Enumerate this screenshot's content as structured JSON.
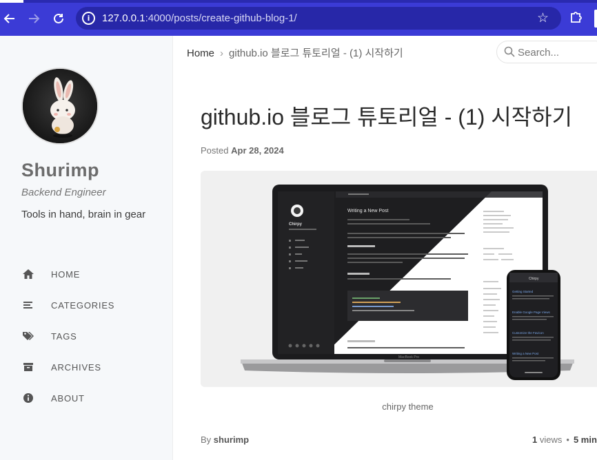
{
  "browser": {
    "url_host": "127.0.0.1",
    "url_path": ":4000/posts/create-github-blog-1/",
    "back_icon": "arrow-left-icon",
    "forward_icon": "arrow-right-icon",
    "reload_icon": "reload-icon",
    "bookmark_icon": "star-icon",
    "extensions_icon": "puzzle-icon"
  },
  "sidebar": {
    "title": "Shurimp",
    "subtitle": "Backend Engineer",
    "description": "Tools in hand, brain in gear",
    "menu": [
      {
        "label": "HOME",
        "icon": "home-icon"
      },
      {
        "label": "CATEGORIES",
        "icon": "stream-icon"
      },
      {
        "label": "TAGS",
        "icon": "tags-icon"
      },
      {
        "label": "ARCHIVES",
        "icon": "archive-icon"
      },
      {
        "label": "ABOUT",
        "icon": "info-icon"
      }
    ]
  },
  "topbar": {
    "breadcrumb_home": "Home",
    "breadcrumb_current": "github.io 블로그 튜토리얼 - (1) 시작하기",
    "search_placeholder": "Search..."
  },
  "post": {
    "title": "github.io 블로그 튜토리얼 - (1) 시작하기",
    "posted_label": "Posted",
    "posted_date": "Apr 28, 2024",
    "image_caption": "chirpy theme",
    "by_label": "By",
    "author": "shurimp",
    "views": "1",
    "views_label": "views",
    "read_time": "5 min"
  },
  "hero_mock": {
    "laptop_post_title": "Writing a New Post",
    "laptop_site_name": "Chirpy",
    "laptop_label": "MacBook Pro",
    "phone_site_name": "Chirpy",
    "phone_posts": [
      "Getting Started",
      "Enable Google Page Views",
      "Customize the Favicon",
      "Writing a New Post"
    ]
  },
  "colors": {
    "chrome": "#3b3bd6",
    "sidebar_bg": "#f6f8fa",
    "link": "#2a408e"
  }
}
